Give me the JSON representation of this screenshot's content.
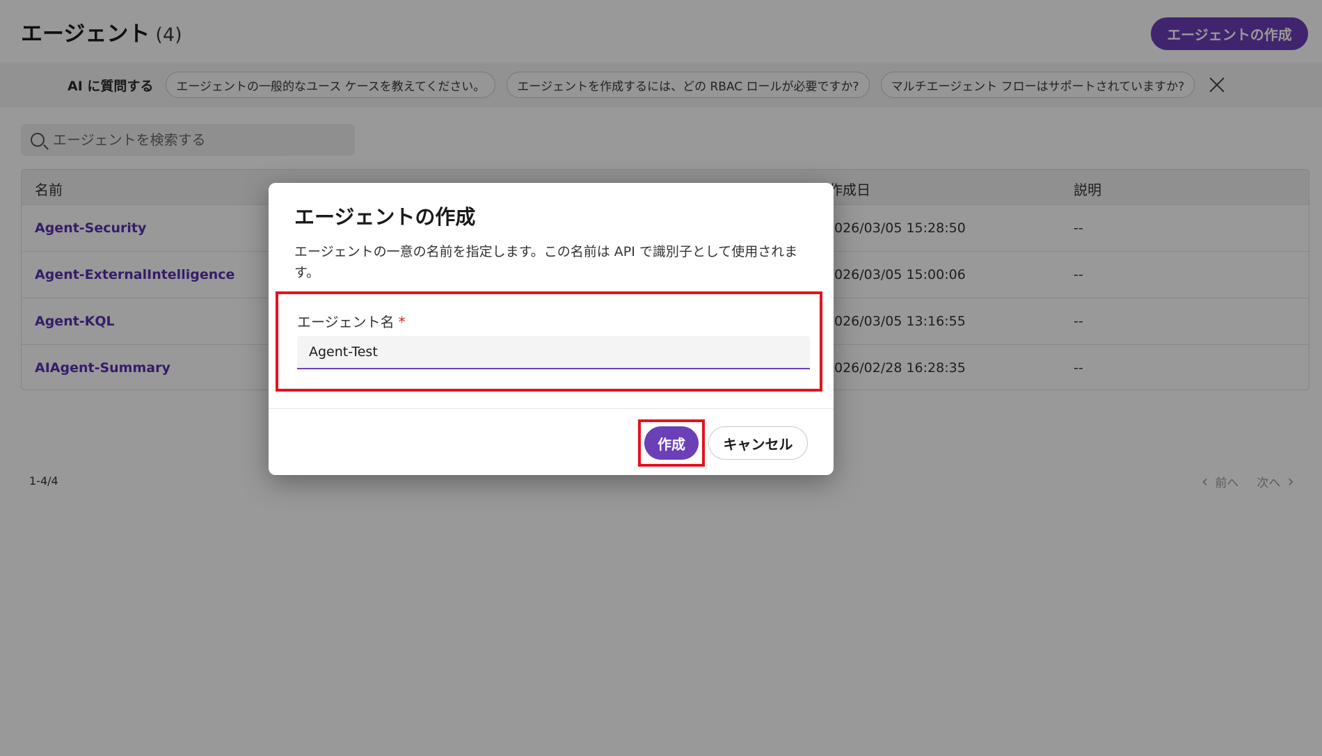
{
  "header": {
    "title": "エージェント",
    "count": "(4)",
    "create_button": "エージェントの作成"
  },
  "ai_bar": {
    "label": "AI に質問する",
    "chips": [
      "エージェントの一般的なユース ケースを教えてください。",
      "エージェントを作成するには、どの RBAC ロールが必要ですか?",
      "マルチエージェント フローはサポートされていますか?"
    ]
  },
  "search": {
    "placeholder": "エージェントを検索する"
  },
  "table": {
    "columns": {
      "name": "名前",
      "created": "作成日",
      "description": "説明"
    },
    "rows": [
      {
        "name": "Agent-Security",
        "created": "026/03/05 15:28:50",
        "description": "--"
      },
      {
        "name": "Agent-ExternalIntelligence",
        "created": "026/03/05 15:00:06",
        "description": "--"
      },
      {
        "name": "Agent-KQL",
        "created": "026/03/05 13:16:55",
        "description": "--"
      },
      {
        "name": "AIAgent-Summary",
        "created": "026/02/28 16:28:35",
        "description": "--"
      }
    ]
  },
  "pagination": {
    "range": "1-4/4",
    "prev": "前へ",
    "next": "次へ"
  },
  "dialog": {
    "title": "エージェントの作成",
    "description": "エージェントの一意の名前を指定します。この名前は API で識別子として使用されます。",
    "field_label": "エージェント名",
    "required_mark": "*",
    "field_value": "Agent-Test",
    "create_button": "作成",
    "cancel_button": "キャンセル"
  },
  "colors": {
    "accent": "#6b3fb8",
    "highlight": "#e5121f"
  }
}
